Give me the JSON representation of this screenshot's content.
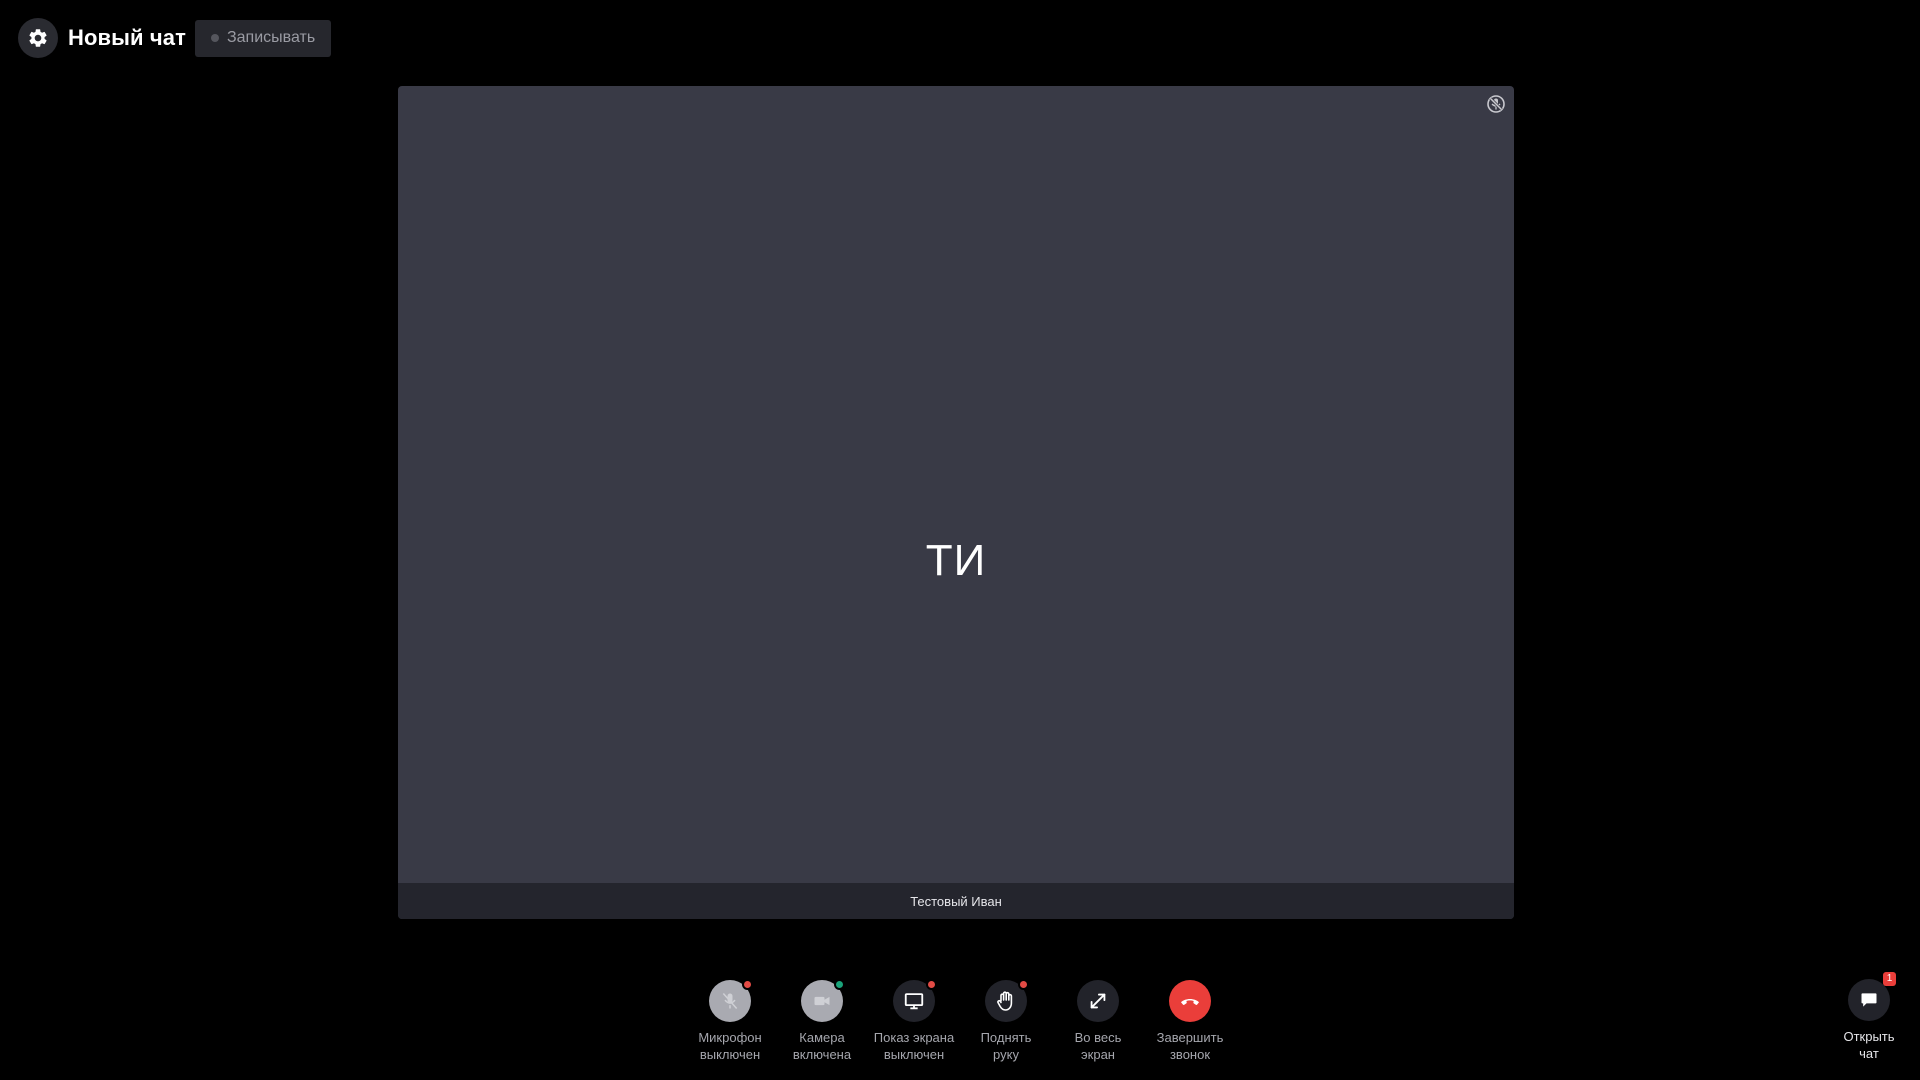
{
  "header": {
    "title": "Новый чат",
    "record_label": "Записывать"
  },
  "tile": {
    "initials": "ТИ",
    "participant_name": "Тестовый Иван"
  },
  "controls": [
    {
      "id": "mic",
      "line1": "Микрофон",
      "line2": "выключен",
      "status_color": "#e24b45"
    },
    {
      "id": "camera",
      "line1": "Камера",
      "line2": "включена",
      "status_color": "#1aa37a"
    },
    {
      "id": "screen",
      "line1": "Показ экрана",
      "line2": "выключен",
      "status_color": "#e24b45"
    },
    {
      "id": "hand",
      "line1": "Поднять",
      "line2": "руку",
      "status_color": "#e24b45"
    },
    {
      "id": "fullscreen",
      "line1": "Во весь",
      "line2": "экран"
    },
    {
      "id": "hangup",
      "line1": "Завершить",
      "line2": "звонок"
    }
  ],
  "chat_toggle": {
    "line1": "Открыть",
    "line2": "чат",
    "unread": "1"
  },
  "colors": {
    "background": "#000000",
    "tile": "#393a46",
    "name_bar": "#24252d",
    "hangup": "#ea3e3a",
    "status_on": "#1aa37a",
    "status_off": "#e24b45"
  }
}
